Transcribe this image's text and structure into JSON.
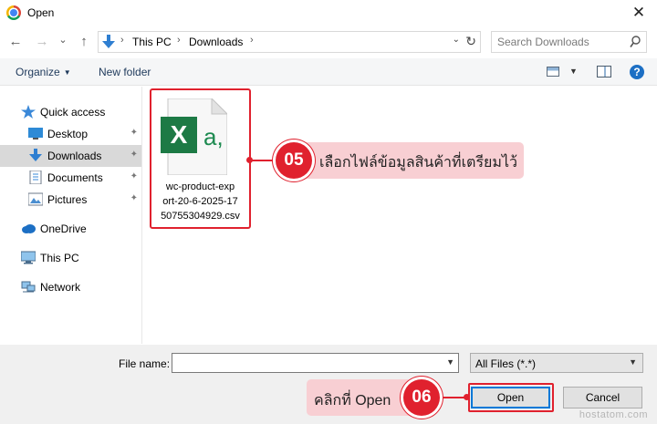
{
  "window": {
    "title": "Open",
    "close_glyph": "✕"
  },
  "nav": {
    "back_glyph": "←",
    "forward_glyph": "→",
    "recent_glyph": "⌄",
    "up_glyph": "↑"
  },
  "address": {
    "crumbs": [
      "This PC",
      "Downloads"
    ],
    "separator": "›",
    "dropdown_glyph": "⌄",
    "refresh_glyph": "↻"
  },
  "search": {
    "placeholder": "Search Downloads"
  },
  "toolbar": {
    "organize_label": "Organize",
    "new_folder_label": "New folder",
    "help_label": "?"
  },
  "sidebar": {
    "items": [
      {
        "label": "Quick access",
        "icon": "star-icon"
      },
      {
        "label": "Desktop",
        "icon": "desktop-icon",
        "pinned": true
      },
      {
        "label": "Downloads",
        "icon": "download-arrow-icon",
        "pinned": true,
        "selected": true
      },
      {
        "label": "Documents",
        "icon": "documents-icon",
        "pinned": true
      },
      {
        "label": "Pictures",
        "icon": "pictures-icon",
        "pinned": true
      },
      {
        "label": "OneDrive",
        "icon": "cloud-icon"
      },
      {
        "label": "This PC",
        "icon": "computer-icon"
      },
      {
        "label": "Network",
        "icon": "network-icon"
      }
    ],
    "pin_glyph": "📌"
  },
  "files": [
    {
      "name_lines": [
        "wc-product-exp",
        "ort-20-6-2025-17",
        "50755304929.csv"
      ],
      "icon": "excel-csv-icon",
      "icon_letter": "X",
      "icon_suffix": "a,"
    }
  ],
  "annotations": {
    "step1": {
      "number": "05",
      "text": "เลือกไฟล์ข้อมูลสินค้าที่เตรียมไว้"
    },
    "step2": {
      "number": "06",
      "text": "คลิกที่ Open"
    }
  },
  "bottom": {
    "file_name_label": "File name:",
    "file_name_value": "",
    "file_type_value": "All Files (*.*)",
    "open_label": "Open",
    "cancel_label": "Cancel"
  },
  "colors": {
    "accent_red": "#e0212e",
    "callout_pink": "#f8cfd3",
    "excel_green": "#1d7a45",
    "focus_blue": "#0078d7"
  },
  "watermark": "hostatom.com"
}
